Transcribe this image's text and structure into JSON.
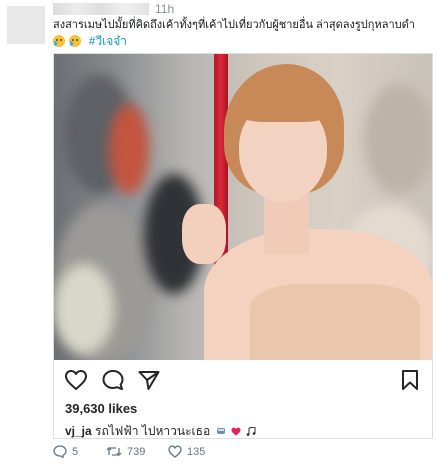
{
  "tweet": {
    "time": "11h",
    "text_line1": "สงสารเมษไปมั้ยที่คิดถึงเค้าทั้งๆที่เค้าไปเที่ยวกับผู้ชายอื่น ล่าสุดลงรูปกุหลาบดำ",
    "hashtag": "#วีเจจ๋า"
  },
  "embed": {
    "likes": "39,630 likes",
    "caption_user": "vj_ja",
    "caption_text": " รถไฟฟ้า ไปหาวนะเธอ"
  },
  "footer": {
    "replies": "5",
    "retweets": "739",
    "likes": "135"
  },
  "colors": {
    "link": "#1b95e0",
    "pole_red": "#d92a3a",
    "heart_red": "#e0245e"
  }
}
